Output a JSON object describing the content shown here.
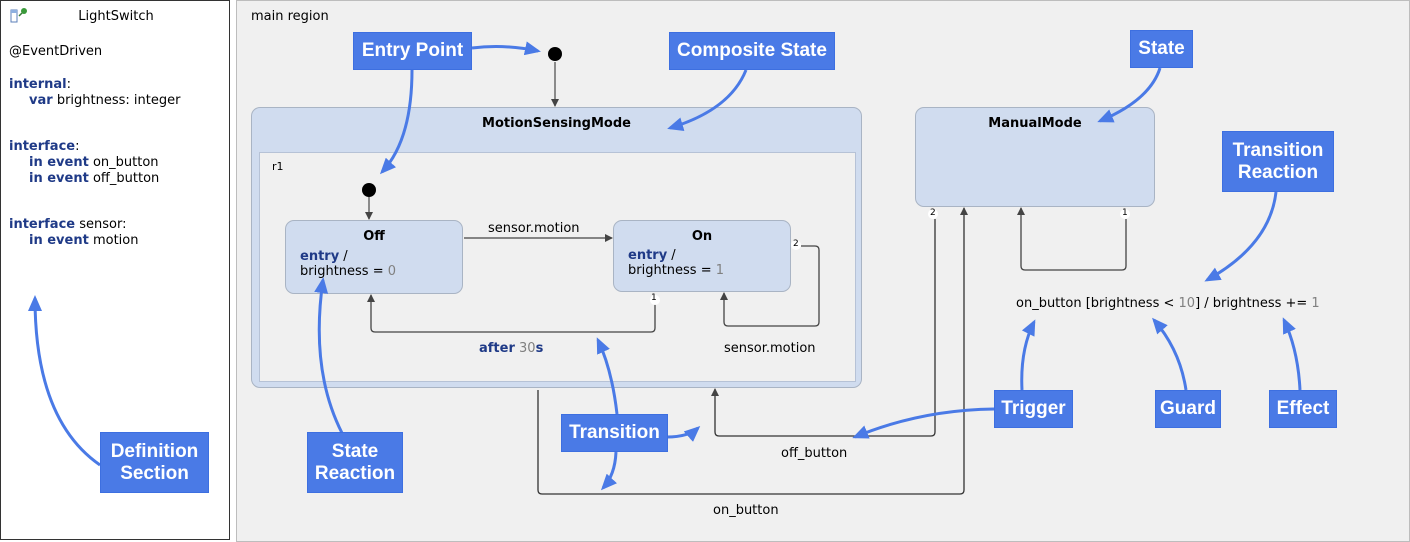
{
  "definition": {
    "title": "LightSwitch",
    "icon": "statechart-pin-icon",
    "annotation": "@EventDriven",
    "internal": {
      "keyword": "internal",
      "var_keyword": "var",
      "var_decl": "brightness: integer"
    },
    "interface": {
      "keyword": "interface",
      "events": [
        {
          "keyword": "in event",
          "name": "on_button"
        },
        {
          "keyword": "in event",
          "name": "off_button"
        }
      ]
    },
    "interface_sensor": {
      "keyword": "interface",
      "name": "sensor:",
      "events": [
        {
          "keyword": "in event",
          "name": "motion"
        }
      ]
    }
  },
  "main": {
    "region_label": "main region",
    "composite_state": {
      "name": "MotionSensingMode",
      "region_label": "r1"
    },
    "states": {
      "off": {
        "name": "Off",
        "entry_kw": "entry",
        "entry_rest": " /",
        "action": "brightness = ",
        "value": "0"
      },
      "on": {
        "name": "On",
        "entry_kw": "entry",
        "entry_rest": " /",
        "action": "brightness = ",
        "value": "1"
      },
      "manual": {
        "name": "ManualMode"
      }
    },
    "transitions": {
      "off_to_on": "sensor.motion",
      "on_to_off_kw": "after",
      "on_to_off_num": "30",
      "on_to_off_unit": "s",
      "on_self": "sensor.motion",
      "off_button": "off_button",
      "on_button": "on_button",
      "manual_self_trigger": "on_button [brightness < ",
      "manual_self_num": "10",
      "manual_self_mid": "] / brightness += ",
      "manual_self_effect_num": "1"
    },
    "priorities": {
      "on_p1": "1",
      "on_p2": "2",
      "manual_p1": "1",
      "manual_p2": "2"
    }
  },
  "callouts": {
    "entry_point": "Entry Point",
    "composite_state": "Composite State",
    "state": "State",
    "transition_reaction": "Transition Reaction",
    "definition_section": "Definition Section",
    "state_reaction": "State Reaction",
    "transition": "Transition",
    "trigger": "Trigger",
    "guard": "Guard",
    "effect": "Effect"
  },
  "colors": {
    "callout": "#4a7ae6",
    "state_fill": "#d0dcef",
    "keyword": "#1f3a87",
    "canvas": "#f0f0f0"
  }
}
